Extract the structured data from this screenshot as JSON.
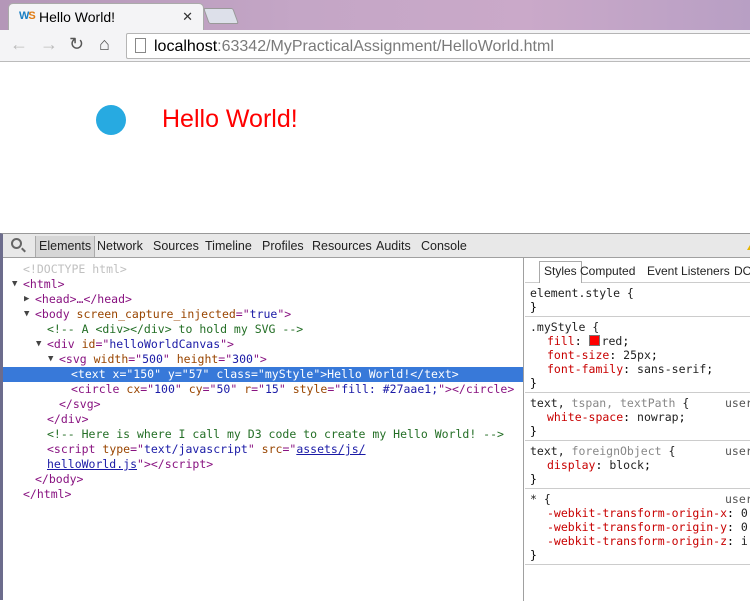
{
  "browser": {
    "tab_title": "Hello World!",
    "favicon": "WS",
    "url_host": "localhost",
    "url_rest": ":63342/MyPracticalAssignment/HelloWorld.html",
    "icons": [
      "back-icon",
      "forward-icon",
      "reload-icon",
      "home-icon",
      "page-icon",
      "close-icon"
    ]
  },
  "page": {
    "circle_color": "#27aae1",
    "text": "Hello World!",
    "text_color": "#ff0000"
  },
  "devtools": {
    "tabs": [
      "Elements",
      "Network",
      "Sources",
      "Timeline",
      "Profiles",
      "Resources",
      "Audits",
      "Console"
    ],
    "selected_tab": "Elements",
    "tree": [
      {
        "d": 0,
        "a": "",
        "tk": [
          [
            "doc",
            "<!DOCTYPE html>"
          ]
        ]
      },
      {
        "d": 0,
        "a": "down",
        "tk": [
          [
            "tag",
            "<html>"
          ]
        ]
      },
      {
        "d": 1,
        "a": "right",
        "tk": [
          [
            "tag",
            "<head>…</head>"
          ]
        ]
      },
      {
        "d": 1,
        "a": "down",
        "tk": [
          [
            "tag",
            "<body "
          ],
          [
            "attr",
            "screen_capture_injected"
          ],
          [
            "tag",
            "=\""
          ],
          [
            "val",
            "true"
          ],
          [
            "tag",
            "\">"
          ]
        ]
      },
      {
        "d": 2,
        "a": "",
        "tk": [
          [
            "com",
            "<!-- A <div></div> to hold my SVG -->"
          ]
        ]
      },
      {
        "d": 2,
        "a": "down",
        "tk": [
          [
            "tag",
            "<div "
          ],
          [
            "attr",
            "id"
          ],
          [
            "tag",
            "=\""
          ],
          [
            "val",
            "helloWorldCanvas"
          ],
          [
            "tag",
            "\">"
          ]
        ]
      },
      {
        "d": 3,
        "a": "down",
        "tk": [
          [
            "tag",
            "<svg "
          ],
          [
            "attr",
            "width"
          ],
          [
            "tag",
            "=\""
          ],
          [
            "val",
            "500"
          ],
          [
            "tag",
            "\" "
          ],
          [
            "attr",
            "height"
          ],
          [
            "tag",
            "=\""
          ],
          [
            "val",
            "300"
          ],
          [
            "tag",
            "\">"
          ]
        ]
      },
      {
        "d": 4,
        "a": "",
        "sel": true,
        "tk": [
          [
            "tag",
            "<text x=\"150\" y=\"57\" class=\"myStyle\">Hello World!</text>"
          ]
        ]
      },
      {
        "d": 4,
        "a": "",
        "tk": [
          [
            "tag",
            "<circle "
          ],
          [
            "attr",
            "cx"
          ],
          [
            "tag",
            "=\""
          ],
          [
            "val",
            "100"
          ],
          [
            "tag",
            "\" "
          ],
          [
            "attr",
            "cy"
          ],
          [
            "tag",
            "=\""
          ],
          [
            "val",
            "50"
          ],
          [
            "tag",
            "\" "
          ],
          [
            "attr",
            "r"
          ],
          [
            "tag",
            "=\""
          ],
          [
            "val",
            "15"
          ],
          [
            "tag",
            "\" "
          ],
          [
            "attr",
            "style"
          ],
          [
            "tag",
            "=\""
          ],
          [
            "val",
            "fill: #27aae1;"
          ],
          [
            "tag",
            "\"></circle>"
          ]
        ]
      },
      {
        "d": 3,
        "a": "",
        "tk": [
          [
            "tag",
            "</svg>"
          ]
        ]
      },
      {
        "d": 2,
        "a": "",
        "tk": [
          [
            "tag",
            "</div>"
          ]
        ]
      },
      {
        "d": 2,
        "a": "",
        "tk": [
          [
            "com",
            "<!-- Here is where I call my D3 code to create my Hello World! -->"
          ]
        ]
      },
      {
        "d": 2,
        "a": "",
        "tk": [
          [
            "tag",
            "<script "
          ],
          [
            "attr",
            "type"
          ],
          [
            "tag",
            "=\""
          ],
          [
            "val",
            "text/javascript"
          ],
          [
            "tag",
            "\" "
          ],
          [
            "attr",
            "src"
          ],
          [
            "tag",
            "=\""
          ],
          [
            "link",
            "assets/js/"
          ]
        ]
      },
      {
        "d": 2,
        "a": "",
        "tk": [
          [
            "link",
            "helloWorld.js"
          ],
          [
            "tag",
            "\"></script>"
          ]
        ]
      },
      {
        "d": 1,
        "a": "",
        "tk": [
          [
            "tag",
            "</body>"
          ]
        ]
      },
      {
        "d": 0,
        "a": "",
        "tk": [
          [
            "tag",
            "</html>"
          ]
        ]
      }
    ],
    "styles_tabs": [
      "Styles",
      "Computed",
      "Event Listeners",
      "DO"
    ],
    "rules": [
      {
        "selector": "element.style {",
        "dim": "",
        "origin": "",
        "props": []
      },
      {
        "selector": ".myStyle {",
        "dim": "",
        "origin": "",
        "props": [
          [
            "fill",
            "red",
            "#ff0000"
          ],
          [
            "font-size",
            "25px"
          ],
          [
            "font-family",
            "sans-serif"
          ]
        ]
      },
      {
        "selector": "text, ",
        "dim": "tspan, textPath",
        "sel_end": " {",
        "origin": "user",
        "props": [
          [
            "white-space",
            "nowrap"
          ]
        ]
      },
      {
        "selector": "text, ",
        "dim": "foreignObject",
        "sel_end": " {",
        "origin": "user",
        "props": [
          [
            "display",
            "block"
          ]
        ]
      },
      {
        "selector": "* {",
        "dim": "",
        "origin": "user",
        "props": [
          [
            "-webkit-transform-origin-x",
            "0"
          ],
          [
            "-webkit-transform-origin-y",
            "0"
          ],
          [
            "-webkit-transform-origin-z",
            "i"
          ]
        ]
      }
    ]
  }
}
